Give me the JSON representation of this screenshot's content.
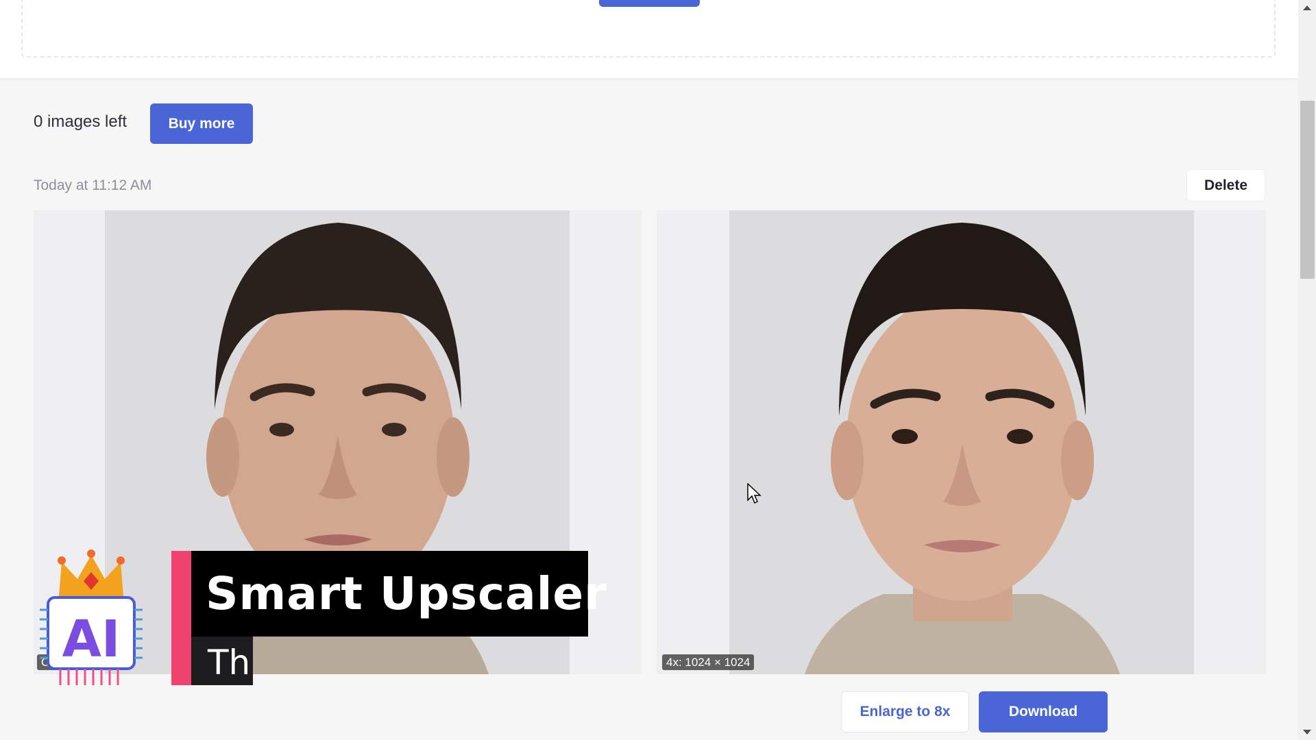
{
  "credits": {
    "text": "0 images left",
    "buy_label": "Buy more"
  },
  "job": {
    "timestamp": "Today at 11:12 AM",
    "delete_label": "Delete",
    "original_badge": "Orig… 256px",
    "result_badge": "4x: 1024 × 1024"
  },
  "actions": {
    "enlarge_label": "Enlarge to 8x",
    "download_label": "Download"
  },
  "overlay": {
    "logo_text": "AI",
    "title": "Smart Upscaler",
    "subtitle": "Th"
  },
  "colors": {
    "accent": "#4a65d6",
    "banner_accent": "#f0426f"
  },
  "icons": [
    "cursor-icon",
    "crown-icon",
    "scroll-up-icon",
    "scroll-down-icon"
  ]
}
